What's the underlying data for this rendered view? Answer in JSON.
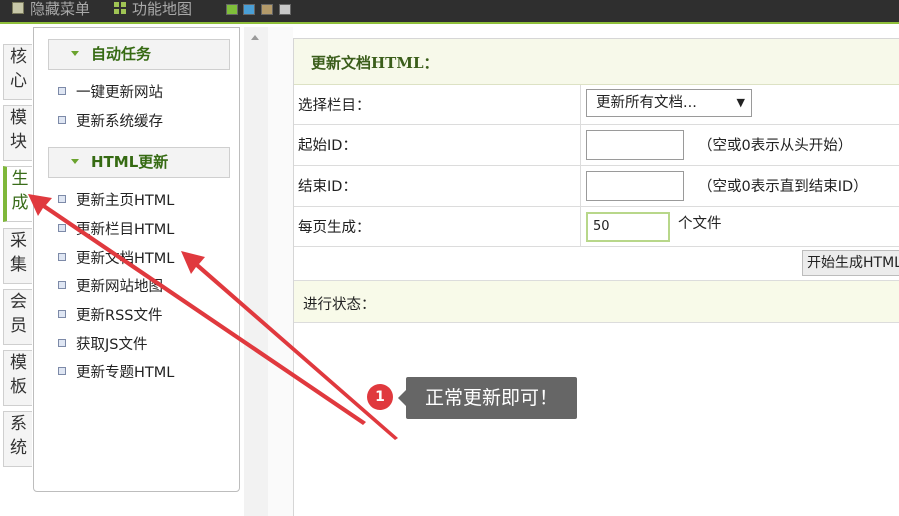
{
  "topbar": {
    "hidden_menu": "隐藏菜单",
    "function_map": "功能地图",
    "skin_colors": [
      "#7fbf3a",
      "#4a9fd6",
      "#b39a6a",
      "#c8c8c8"
    ]
  },
  "left_tabs": [
    {
      "label": "核心",
      "active": false
    },
    {
      "label": "模块",
      "active": false
    },
    {
      "label": "生成",
      "active": true
    },
    {
      "label": "采集",
      "active": false
    },
    {
      "label": "会员",
      "active": false
    },
    {
      "label": "模板",
      "active": false
    },
    {
      "label": "系统",
      "active": false
    }
  ],
  "menu": {
    "section1": {
      "title": "自动任务",
      "items": [
        "一键更新网站",
        "更新系统缓存"
      ]
    },
    "section2": {
      "title": "HTML更新",
      "items": [
        "更新主页HTML",
        "更新栏目HTML",
        "更新文档HTML",
        "更新网站地图",
        "更新RSS文件",
        "获取JS文件",
        "更新专题HTML"
      ]
    }
  },
  "form": {
    "title": "更新文档HTML：",
    "rows": {
      "category": {
        "label": "选择栏目：",
        "value": "更新所有文档..."
      },
      "start_id": {
        "label": "起始ID：",
        "value": "",
        "hint": "（空或0表示从头开始）"
      },
      "end_id": {
        "label": "结束ID：",
        "value": "",
        "hint": "（空或0表示直到结束ID）"
      },
      "per_page": {
        "label": "每页生成：",
        "value": "50",
        "unit": "个文件"
      }
    },
    "start_button": "开始生成HTML",
    "status_label": "进行状态："
  },
  "annotation": {
    "badge": "1",
    "text": "正常更新即可！",
    "arrow_color": "#e0393e"
  }
}
